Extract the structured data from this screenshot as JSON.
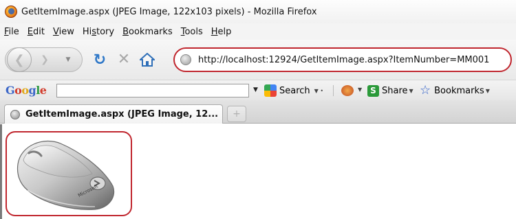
{
  "window": {
    "title": "GetItemImage.aspx (JPEG Image, 122x103 pixels) - Mozilla Firefox"
  },
  "menubar": {
    "items": [
      {
        "pre": "",
        "key": "F",
        "rest": "ile"
      },
      {
        "pre": "",
        "key": "E",
        "rest": "dit"
      },
      {
        "pre": "",
        "key": "V",
        "rest": "iew"
      },
      {
        "pre": "Hi",
        "key": "s",
        "rest": "tory"
      },
      {
        "pre": "",
        "key": "B",
        "rest": "ookmarks"
      },
      {
        "pre": "",
        "key": "T",
        "rest": "ools"
      },
      {
        "pre": "",
        "key": "H",
        "rest": "elp"
      }
    ]
  },
  "navbar": {
    "url": "http://localhost:12924/GetItemImage.aspx?ItemNumber=MM001",
    "url_highlight_color": "#c0262e",
    "icons": [
      "back-icon",
      "forward-icon",
      "history-dropdown-icon",
      "reload-icon",
      "stop-icon",
      "home-icon",
      "site-identity-icon"
    ]
  },
  "google_toolbar": {
    "logo": "Google",
    "search_value": "",
    "search_label": "Search",
    "share_label": "Share",
    "bookmarks_label": "Bookmarks"
  },
  "tabs": [
    {
      "label": "GetItemImage.aspx (JPEG Image, 12...",
      "active": true
    }
  ],
  "content": {
    "image_description": "computer mouse",
    "image_brand": "Microsoft",
    "image_size": "122x103",
    "highlight_color": "#c0262e"
  }
}
